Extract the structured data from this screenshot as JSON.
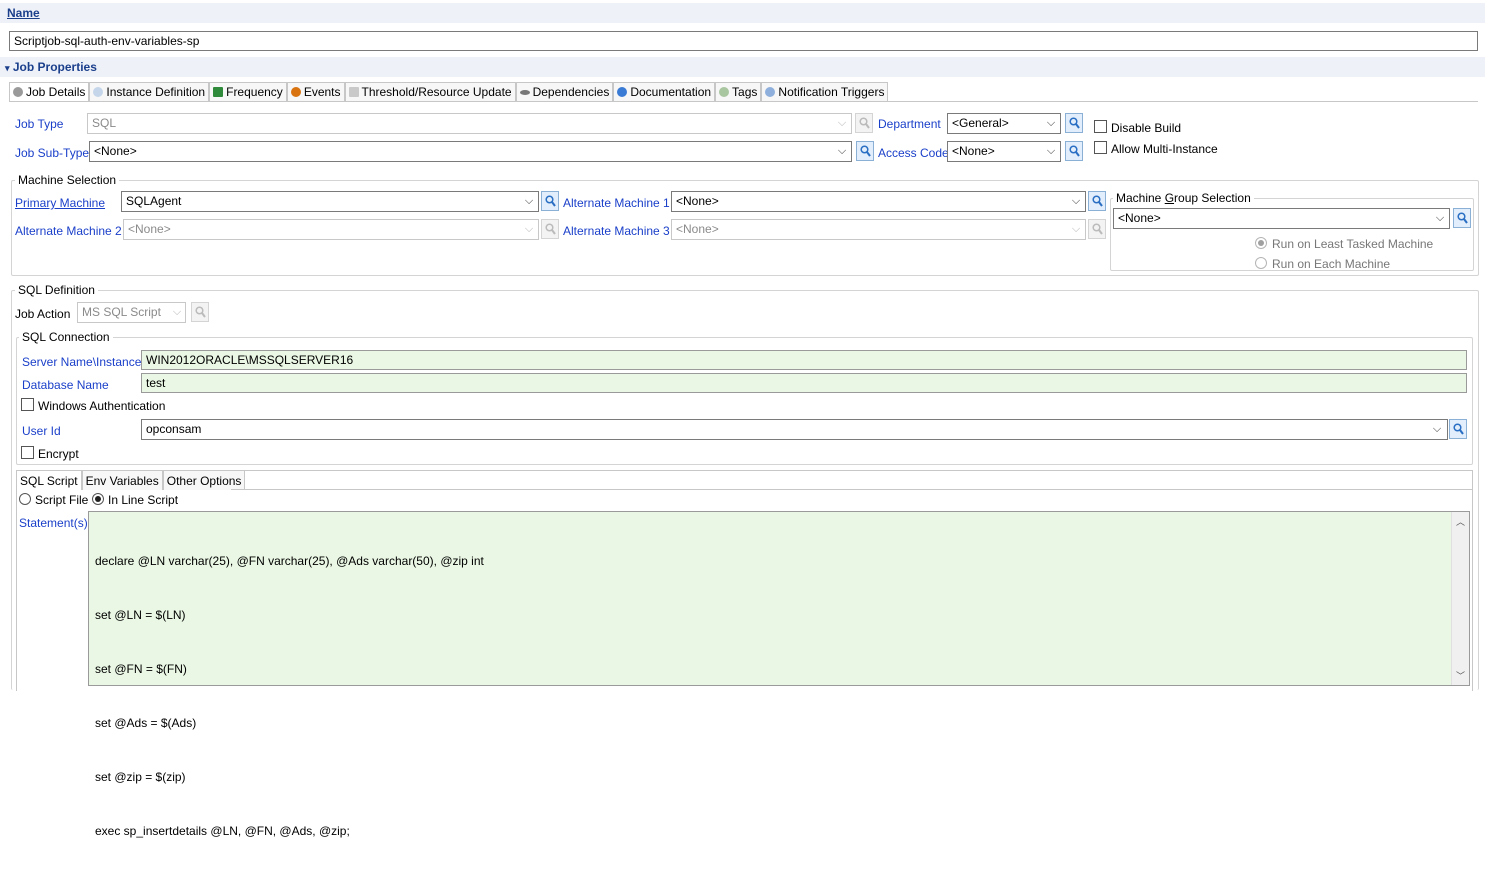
{
  "name_section": {
    "title": "Name",
    "value": "Scriptjob-sql-auth-env-variables-sp"
  },
  "job_properties": {
    "title": "Job Properties"
  },
  "tabs": [
    {
      "label": "Job Details",
      "icon": "gear-icon"
    },
    {
      "label": "Instance Definition",
      "icon": "pen-icon"
    },
    {
      "label": "Frequency",
      "icon": "calendar-icon"
    },
    {
      "label": "Events",
      "icon": "alert-icon"
    },
    {
      "label": "Threshold/Resource Update",
      "icon": "resource-icon"
    },
    {
      "label": "Dependencies",
      "icon": "link-icon"
    },
    {
      "label": "Documentation",
      "icon": "info-icon"
    },
    {
      "label": "Tags",
      "icon": "tag-icon"
    },
    {
      "label": "Notification Triggers",
      "icon": "bell-icon"
    }
  ],
  "job_type": {
    "label": "Job Type",
    "value": "SQL"
  },
  "job_sub_type": {
    "label": "Job Sub-Type",
    "value": "<None>"
  },
  "department": {
    "label": "Department",
    "value": "<General>"
  },
  "access_code": {
    "label": "Access Code",
    "value": "<None>"
  },
  "disable_build": {
    "label": "Disable Build",
    "checked": false
  },
  "allow_multi_instance": {
    "label": "Allow Multi-Instance",
    "checked": false
  },
  "machine_selection": {
    "title": "Machine Selection",
    "primary": {
      "label": "Primary Machine",
      "value": "SQLAgent"
    },
    "alt1": {
      "label": "Alternate Machine 1",
      "value": "<None>"
    },
    "alt2": {
      "label": "Alternate Machine 2",
      "value": "<None>"
    },
    "alt3": {
      "label": "Alternate Machine 3",
      "value": "<None>"
    },
    "group": {
      "title_pre": "Machine ",
      "title_u": "G",
      "title_post": "roup Selection",
      "value": "<None>",
      "opt_least": "Run on Least Tasked Machine",
      "opt_each": "Run on Each Machine",
      "selected": "least"
    }
  },
  "sql_definition": {
    "title": "SQL Definition",
    "job_action": {
      "label": "Job Action",
      "value": "MS SQL Script"
    },
    "connection": {
      "title": "SQL Connection",
      "server": {
        "label": "Server Name\\Instance",
        "value": "WIN2012ORACLE\\MSSQLSERVER16"
      },
      "database": {
        "label": "Database Name",
        "value": "test"
      },
      "windows_auth": {
        "label": "Windows Authentication",
        "checked": false
      },
      "user": {
        "label": "User Id",
        "value": "opconsam"
      },
      "encrypt": {
        "label": "Encrypt",
        "checked": false
      }
    },
    "subtabs": [
      "SQL Script",
      "Env Variables",
      "Other Options"
    ],
    "script_file_label": "Script File",
    "inline_label": "In Line Script",
    "script_mode": "inline",
    "statements_label": "Statement(s)",
    "statements": [
      "declare @LN varchar(25), @FN varchar(25), @Ads varchar(50), @zip int",
      "set @LN = $(LN)",
      "set @FN = $(FN)",
      "set @Ads = $(Ads)",
      "set @zip = $(zip)",
      "exec sp_insertdetails @LN, @FN, @Ads, @zip;"
    ]
  },
  "colors": {
    "label_blue": "#1a3fc9",
    "field_green": "#eaf7e4",
    "section_bg": "#eef2f8"
  }
}
